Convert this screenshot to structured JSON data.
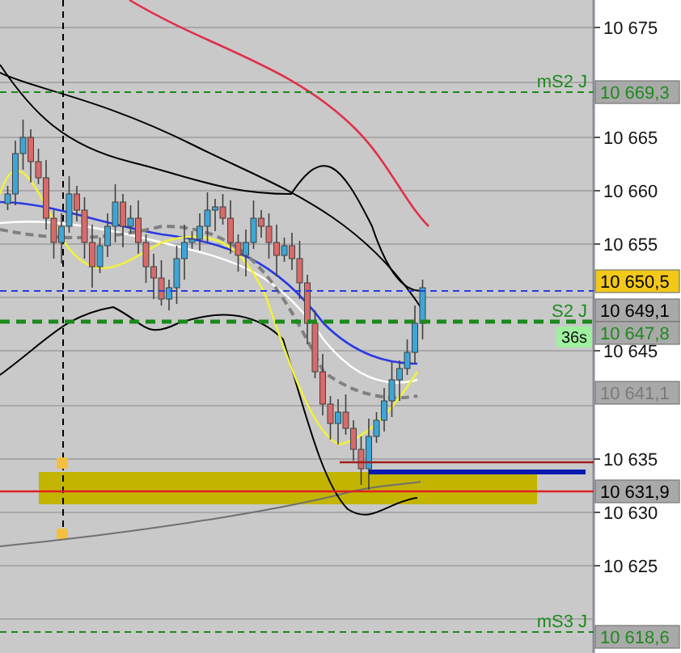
{
  "price_axis": {
    "ticks": [
      "10 675",
      "10 665",
      "10 660",
      "10 655",
      "10 645",
      "10 635",
      "10 630",
      "10 625"
    ]
  },
  "levels": [
    {
      "label": "mS2 J"
    },
    {
      "label": "S2 J"
    },
    {
      "label": "mS3 J"
    }
  ],
  "price_tags": [
    {
      "label": "10 669,3",
      "kind": "level"
    },
    {
      "label": "10 650,5",
      "kind": "current"
    },
    {
      "label": "10 649,1",
      "kind": "plain"
    },
    {
      "label": "10 647,8",
      "kind": "level"
    },
    {
      "label": "10 641,1",
      "kind": "muted"
    },
    {
      "label": "10 631,9",
      "kind": "plain"
    },
    {
      "label": "10 618,6",
      "kind": "level"
    }
  ],
  "timer": "36s"
}
